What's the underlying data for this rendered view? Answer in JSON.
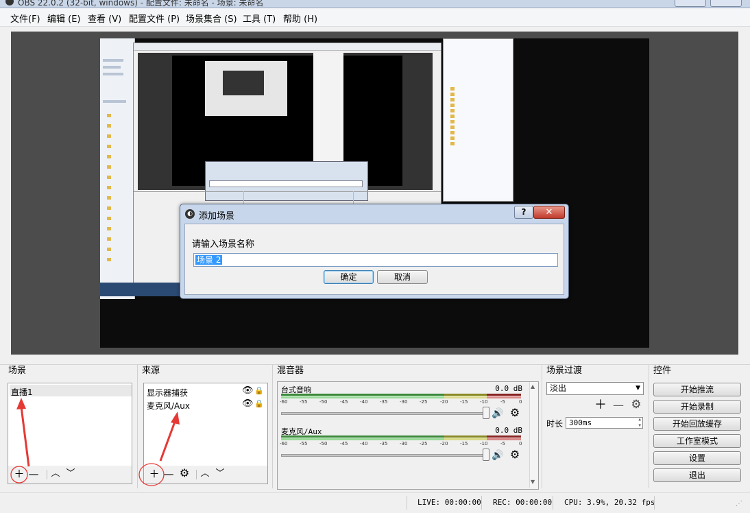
{
  "window": {
    "title": "OBS 22.0.2 (32-bit, windows) - 配置文件: 未命名 - 场景: 未命名"
  },
  "menu": [
    "文件(F)",
    "编辑 (E)",
    "查看 (V)",
    "配置文件 (P)",
    "场景集合 (S)",
    "工具 (T)",
    "帮助 (H)"
  ],
  "dialog": {
    "title": "添加场景",
    "help": "?",
    "close": "✕",
    "prompt": "请输入场景名称",
    "input_value": "场景 2",
    "ok": "确定",
    "cancel": "取消"
  },
  "docks": {
    "scenes": {
      "title": "场景",
      "items": [
        "直播1"
      ]
    },
    "sources": {
      "title": "来源",
      "items": [
        "显示器捕获",
        "麦克风/Aux"
      ]
    },
    "mixer": {
      "title": "混音器",
      "channels": [
        {
          "name": "台式音响",
          "db": "0.0 dB"
        },
        {
          "name": "麦克风/Aux",
          "db": "0.0 dB"
        }
      ],
      "scale": [
        "-60",
        "-55",
        "-50",
        "-45",
        "-40",
        "-35",
        "-30",
        "-25",
        "-20",
        "-15",
        "-10",
        "-5",
        "0"
      ]
    },
    "transitions": {
      "title": "场景过渡",
      "selected": "淡出",
      "duration_label": "时长",
      "duration_value": "300ms"
    },
    "controls": {
      "title": "控件",
      "buttons": [
        "开始推流",
        "开始录制",
        "开始回放缓存",
        "工作室模式",
        "设置",
        "退出"
      ]
    }
  },
  "status": {
    "live": "LIVE: 00:00:00",
    "rec": "REC: 00:00:00",
    "cpu": "CPU: 3.9%, 20.32 fps"
  },
  "colors": {
    "meter_green": "#50c850",
    "meter_yellow": "#c8c832",
    "meter_red": "#c83232",
    "annotation": "#e53935"
  }
}
